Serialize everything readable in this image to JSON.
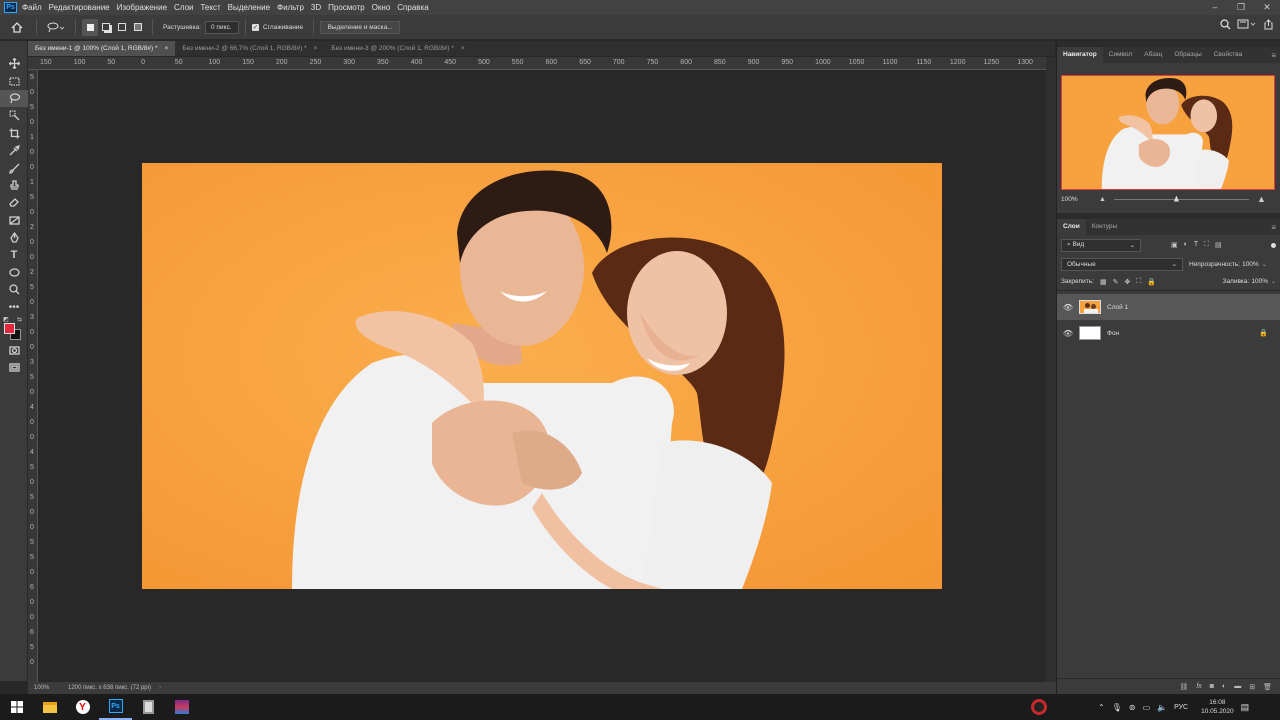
{
  "menubar": {
    "app_logo": "Ps",
    "items": [
      "Файл",
      "Редактирование",
      "Изображение",
      "Слои",
      "Текст",
      "Выделение",
      "Фильтр",
      "3D",
      "Просмотр",
      "Окно",
      "Справка"
    ]
  },
  "options": {
    "feather_label": "Растушевка:",
    "feather_value": "0 пикс.",
    "antialias_label": "Сглаживание",
    "select_mask_button": "Выделение и маска..."
  },
  "tabs": [
    {
      "label": "Без имени-1 @ 100% (Слой 1, RGB/8#) *",
      "active": true
    },
    {
      "label": "Без имени-2 @ 66,7% (Слой 1, RGB/8#) *",
      "active": false
    },
    {
      "label": "Без имени-3 @ 200% (Слой 1, RGB/8#) *",
      "active": false
    }
  ],
  "ruler_h": [
    "150",
    "100",
    "50",
    "0",
    "50",
    "100",
    "150",
    "200",
    "250",
    "300",
    "350",
    "400",
    "450",
    "500",
    "550",
    "600",
    "650",
    "700",
    "750",
    "800",
    "850",
    "900",
    "950",
    "1000",
    "1050",
    "1100",
    "1150",
    "1200",
    "1250",
    "1300"
  ],
  "ruler_v": [
    "5",
    "0",
    "5",
    "0",
    "1",
    "0",
    "0",
    "1",
    "5",
    "0",
    "2",
    "0",
    "0",
    "2",
    "5",
    "0",
    "3",
    "0",
    "0",
    "3",
    "5",
    "0",
    "4",
    "0",
    "0",
    "4",
    "5",
    "0",
    "5",
    "0",
    "0",
    "5",
    "5",
    "0",
    "6",
    "0",
    "0",
    "6",
    "5",
    "0"
  ],
  "status": {
    "zoom": "100%",
    "doc_info": "1200 пикс. x 638 пикс. (72 ppi)"
  },
  "navigator": {
    "tabs": [
      "Навигатор",
      "Символ",
      "Абзац",
      "Образцы",
      "Свойства"
    ],
    "zoom": "100%"
  },
  "layers_panel": {
    "tabs": [
      "Слои",
      "Контуры"
    ],
    "filter_label": "Вид",
    "blend_mode": "Обычные",
    "opacity_label": "Непрозрачность:",
    "opacity_value": "100%",
    "lock_label": "Закрепить:",
    "fill_label": "Заливка:",
    "fill_value": "100%",
    "layers": [
      {
        "name": "Слой 1",
        "selected": true
      },
      {
        "name": "Фон",
        "selected": false
      }
    ]
  },
  "taskbar": {
    "lang": "РУС",
    "time": "16:08",
    "date": "10.05.2020"
  },
  "colors": {
    "photo_bg": "#f7a23e",
    "foreground_swatch": "#e3273e",
    "nav_frame": "#e03a3a"
  }
}
